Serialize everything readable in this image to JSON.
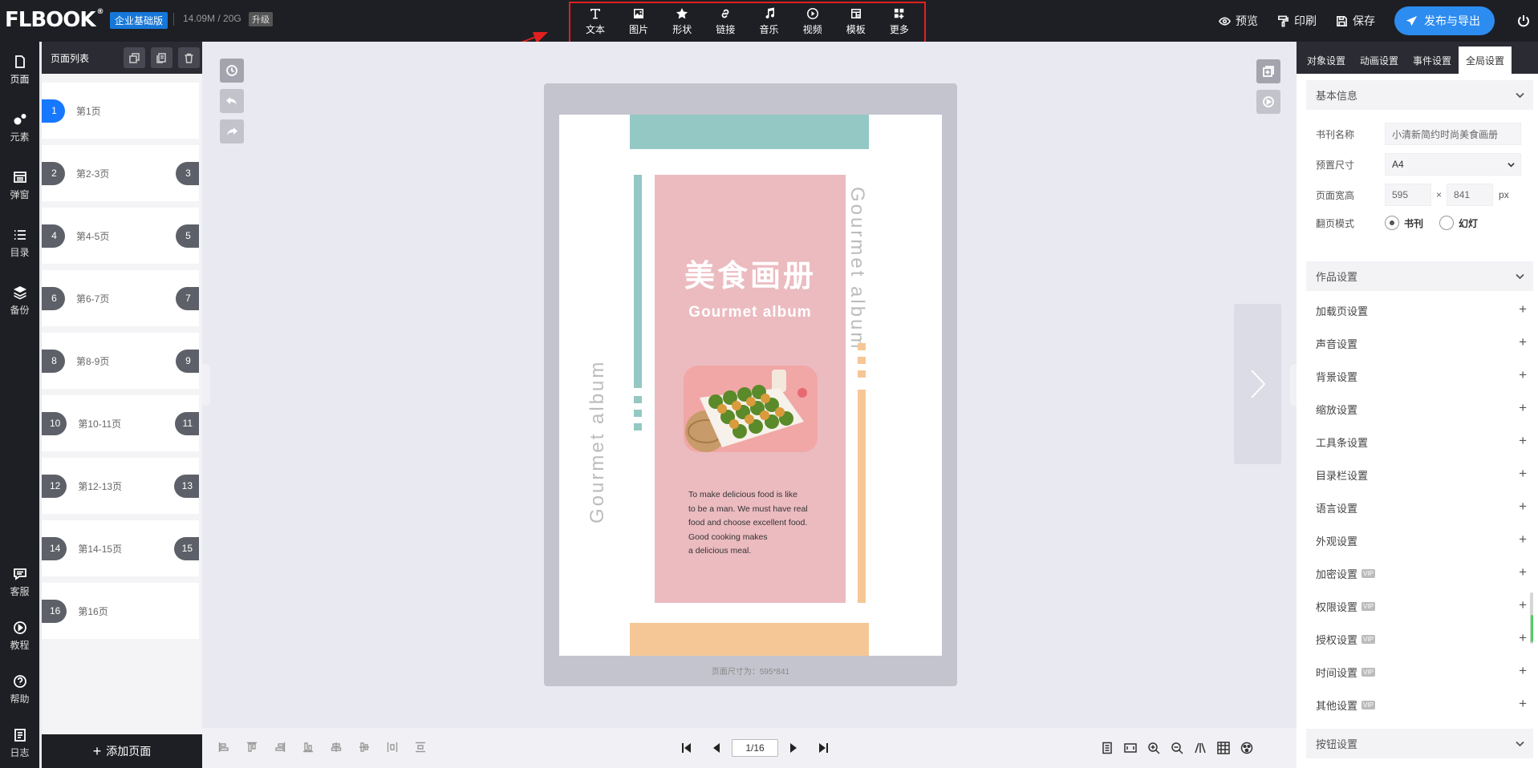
{
  "topbar": {
    "logo": "FLBOOK",
    "logo_mark": "®",
    "edition": "企业基础版",
    "storage": "14.09M / 20G",
    "upgrade": "升级",
    "tools": [
      "文本",
      "图片",
      "形状",
      "链接",
      "音乐",
      "视频",
      "模板",
      "更多"
    ],
    "preview": "预览",
    "print": "印刷",
    "save": "保存",
    "publish": "发布与导出"
  },
  "leftnav": {
    "items": [
      "页面",
      "元素",
      "弹窗",
      "目录",
      "备份"
    ],
    "bottom": [
      "客服",
      "教程",
      "帮助",
      "日志"
    ]
  },
  "pagelist": {
    "title": "页面列表",
    "pages": [
      {
        "left": "1",
        "label": "第1页",
        "right": ""
      },
      {
        "left": "2",
        "label": "第2-3页",
        "right": "3"
      },
      {
        "left": "4",
        "label": "第4-5页",
        "right": "5"
      },
      {
        "left": "6",
        "label": "第6-7页",
        "right": "7"
      },
      {
        "left": "8",
        "label": "第8-9页",
        "right": "9"
      },
      {
        "left": "10",
        "label": "第10-11页",
        "right": "11"
      },
      {
        "left": "12",
        "label": "第12-13页",
        "right": "13"
      },
      {
        "left": "14",
        "label": "第14-15页",
        "right": "15"
      },
      {
        "left": "16",
        "label": "第16页",
        "right": ""
      }
    ],
    "add_page": "添加页面"
  },
  "page": {
    "title_cn": "美食画册",
    "title_en": "Gourmet album",
    "side_text": "Gourmet album",
    "body": [
      "To make delicious food is like",
      "to be a man. We must have real",
      "food and choose excellent food.",
      "Good cooking makes",
      "a delicious meal."
    ],
    "size_note": "页面尺寸为：595*841",
    "colors": {
      "pink": "#ebbbc0",
      "teal": "#94c8c4",
      "peach": "#f6c796"
    }
  },
  "pager": {
    "current": "1/16"
  },
  "rpanel": {
    "tabs": [
      "对象设置",
      "动画设置",
      "事件设置",
      "全局设置"
    ],
    "basic": {
      "title": "基本信息",
      "name_label": "书刊名称",
      "name_value": "小清新简约时尚美食画册",
      "size_label": "预置尺寸",
      "size_value": "A4",
      "wh_label": "页面宽高",
      "width": "595",
      "x": "×",
      "height": "841",
      "unit": "px",
      "mode_label": "翻页模式",
      "mode_book": "书刊",
      "mode_slide": "幻灯"
    },
    "works": {
      "title": "作品设置",
      "items": [
        {
          "label": "加载页设置",
          "vip": ""
        },
        {
          "label": "声音设置",
          "vip": ""
        },
        {
          "label": "背景设置",
          "vip": ""
        },
        {
          "label": "缩放设置",
          "vip": ""
        },
        {
          "label": "工具条设置",
          "vip": ""
        },
        {
          "label": "目录栏设置",
          "vip": ""
        },
        {
          "label": "语言设置",
          "vip": ""
        },
        {
          "label": "外观设置",
          "vip": ""
        },
        {
          "label": "加密设置",
          "vip": "VIP"
        },
        {
          "label": "权限设置",
          "vip": "VIP"
        },
        {
          "label": "授权设置",
          "vip": "VIP"
        },
        {
          "label": "时间设置",
          "vip": "VIP"
        },
        {
          "label": "其他设置",
          "vip": "VIP"
        }
      ],
      "plus": "+"
    },
    "button_settings": "按钮设置"
  }
}
